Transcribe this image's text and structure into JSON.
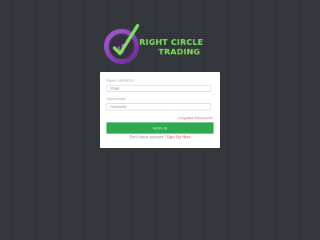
{
  "brand": {
    "line1": "RIGHT CIRCLE",
    "line2": "TRADING",
    "logo_icon": "circle-checkmark-chart-icon",
    "colors": {
      "ring_purple": "#8e3fc0",
      "check_green": "#7ee35a",
      "text_green": "#7ee35a"
    }
  },
  "form": {
    "email_label": "EMAIL ADDRESS",
    "email_placeholder": "Email",
    "password_label": "PASSWORD",
    "password_placeholder": "Password",
    "forgot_label": "Forgotten Password?",
    "signin_label": "SIGN IN"
  },
  "signup": {
    "prompt": "Don't have account |",
    "link_label": "Sign Up Here"
  },
  "colors": {
    "background": "#32363b",
    "card": "#ffffff",
    "button": "#2fa84f",
    "link": "#e0556a"
  }
}
